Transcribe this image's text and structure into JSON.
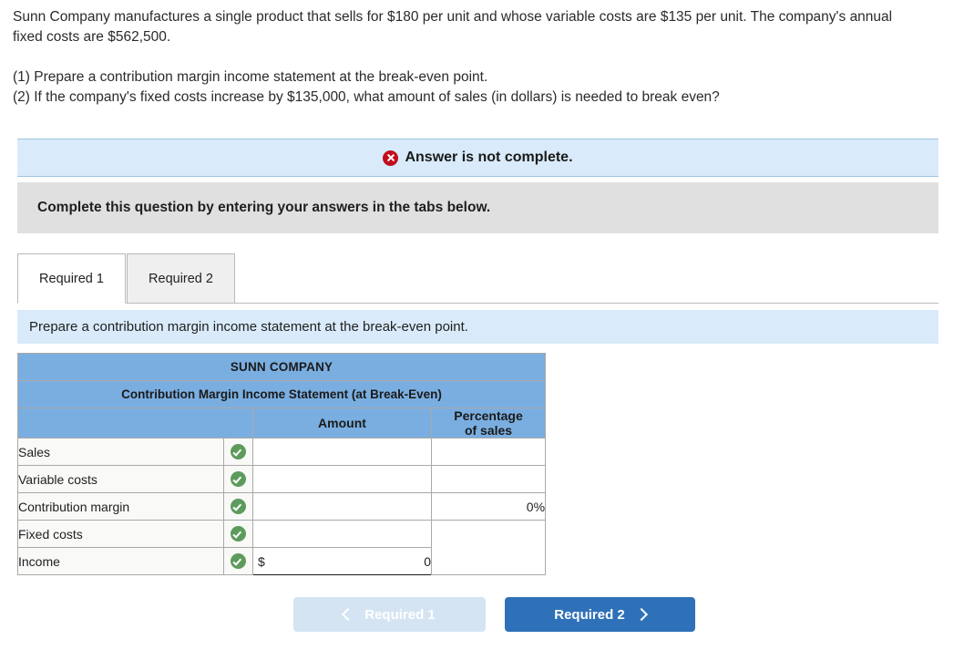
{
  "problem": {
    "paragraph_1": "Sunn Company manufactures a single product that sells for $180 per unit and whose variable costs are $135 per unit. The company's annual fixed costs are $562,500.",
    "requirement_1": "(1) Prepare a contribution margin income statement at the break-even point.",
    "requirement_2": "(2) If the company's fixed costs increase by $135,000, what amount of sales (in dollars) is needed to break even?"
  },
  "status": {
    "icon": "x-circle-icon",
    "message": "Answer is not complete.",
    "banner_color": "#d9ebfa",
    "icon_color": "#c00d1e"
  },
  "instruction": {
    "text": "Complete this question by entering your answers in the tabs below."
  },
  "tabs": [
    {
      "label": "Required 1",
      "active": true
    },
    {
      "label": "Required 2",
      "active": false
    }
  ],
  "task_prompt": {
    "text": "Prepare a contribution margin income statement at the break-even point."
  },
  "table": {
    "company": "SUNN COMPANY",
    "subtitle": "Contribution Margin Income Statement (at Break-Even)",
    "columns": {
      "blank": "",
      "amount": "Amount",
      "percentage_line1": "Percentage",
      "percentage_line2": "of sales"
    },
    "header_color": "#7aaee0",
    "rows": [
      {
        "label": "Sales",
        "status_icon": "check-circle-icon",
        "amount": "",
        "dollar": "",
        "percentage": ""
      },
      {
        "label": "Variable costs",
        "status_icon": "check-circle-icon",
        "amount": "",
        "dollar": "",
        "percentage": ""
      },
      {
        "label": "Contribution margin",
        "status_icon": "check-circle-icon",
        "amount": "",
        "dollar": "",
        "percentage": "0%"
      },
      {
        "label": "Fixed costs",
        "status_icon": "check-circle-icon",
        "amount": "",
        "dollar": "",
        "percentage": ""
      },
      {
        "label": "Income",
        "status_icon": "check-circle-icon",
        "amount": "0",
        "dollar": "$",
        "percentage": ""
      }
    ]
  },
  "navigation": {
    "prev_label": "Required 1",
    "next_label": "Required 2",
    "prev_icon": "chevron-left-icon",
    "next_icon": "chevron-right-icon",
    "prev_color": "#d4e4f2",
    "next_color": "#2e71b8"
  }
}
